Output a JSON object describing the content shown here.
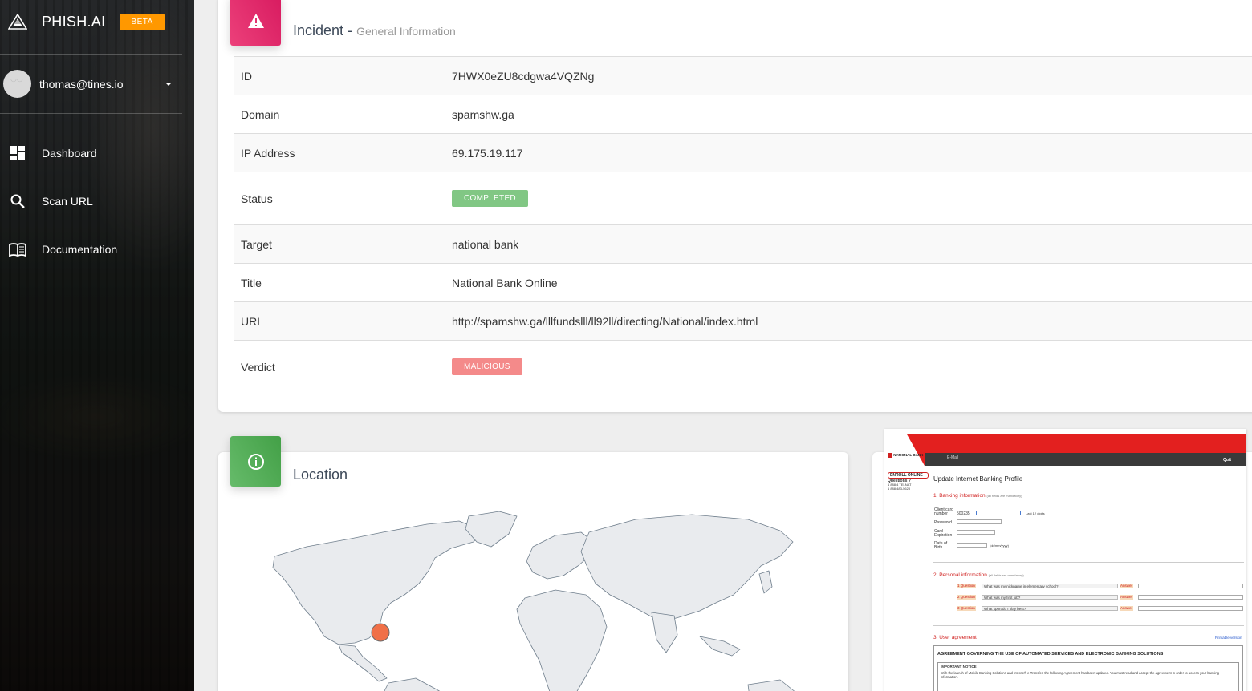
{
  "app": {
    "name": "PHISH.AI",
    "beta_label": "BETA"
  },
  "user": {
    "email": "thomas@tines.io"
  },
  "nav": [
    {
      "label": "Dashboard",
      "icon": "dashboard-icon"
    },
    {
      "label": "Scan URL",
      "icon": "search-icon"
    },
    {
      "label": "Documentation",
      "icon": "book-icon"
    }
  ],
  "incident": {
    "title": "Incident -",
    "subtitle": "General Information",
    "rows": [
      {
        "key": "ID",
        "value": "7HWX0eZU8cdgwa4VQZNg"
      },
      {
        "key": "Domain",
        "value": "spamshw.ga"
      },
      {
        "key": "IP Address",
        "value": "69.175.19.117"
      },
      {
        "key": "Status",
        "value": "COMPLETED",
        "badge": "completed",
        "badge_color": "#81c784"
      },
      {
        "key": "Target",
        "value": "national bank"
      },
      {
        "key": "Title",
        "value": "National Bank Online"
      },
      {
        "key": "URL",
        "value": "http://spamshw.ga/lllfundslll/ll92ll/directing/National/index.html"
      },
      {
        "key": "Verdict",
        "value": "MALICIOUS",
        "badge": "malicious",
        "badge_color": "#f48a8a"
      }
    ]
  },
  "location": {
    "title": "Location",
    "marker_color": "#f07048"
  },
  "screenshot": {
    "brand": "NATIONAL BANK",
    "email_link": "E-Mail",
    "quit": "Quit",
    "enroll": "ENROLL ONLINE",
    "questions": "Questions ?",
    "phone1": "1 888 4 TELNAT",
    "phone2": "1 888 483-5628",
    "heading": "Update Internet Banking Profile",
    "section1": "1. Banking information",
    "section1_note": "(all fields are mandatory)",
    "client_card": "Client card number",
    "card_prefix": "500235",
    "last_digits": "Last 12 digits",
    "password": "Password",
    "card_expiration": "Card Expiration",
    "dob": "Date of Birth",
    "dob_hint": "(dd/mm/yyyy)",
    "section2": "2. Personal information",
    "section2_note": "(all fields are mandatory)",
    "question_label": "Question",
    "answer_label": "Answer",
    "q1": "What was my nickname in elementary school?",
    "q2": "What was my first job?",
    "q3": "What sport do I play best?",
    "section3": "3. User agreement",
    "printable": "Printable version",
    "agreement_title": "AGREEMENT GOVERNING THE USE OF AUTOMATED SERVICES AND ELECTRONIC BANKING SOLUTIONS",
    "important": "IMPORTANT NOTICE",
    "notice": "With the launch of Mobile Banking Solutions and Interac® e-Transfer, the following Agreement has been updated. You must read and accept the agreement in order to access your banking information."
  }
}
